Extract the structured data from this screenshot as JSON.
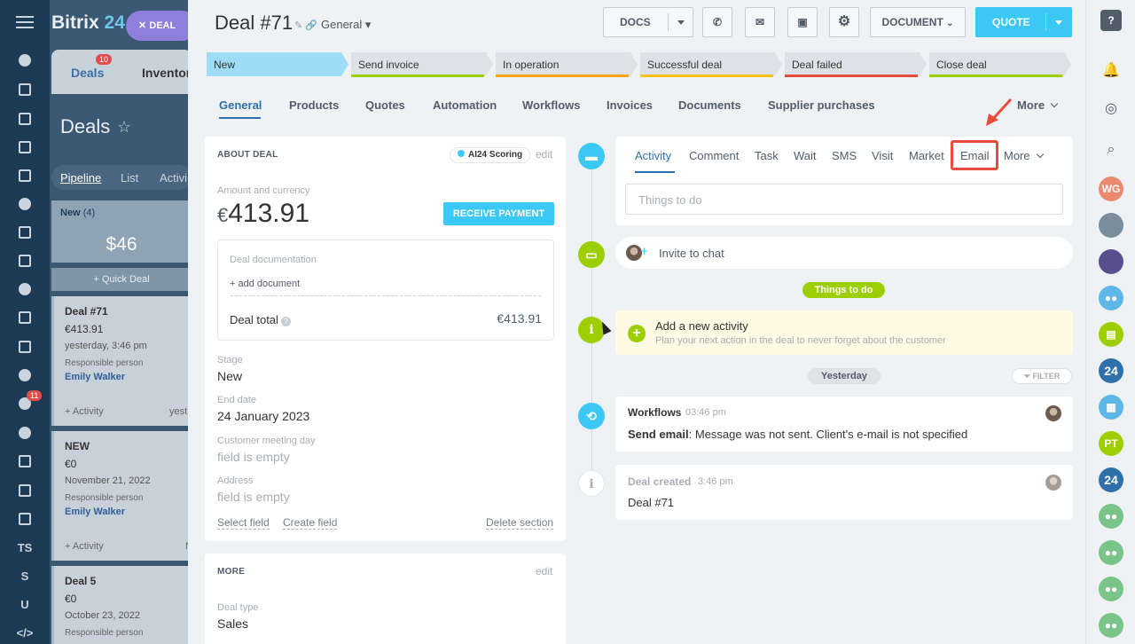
{
  "background": {
    "logo_text": "Bitrix",
    "logo_num": "24",
    "deal_chip": "DEAL",
    "tabs": {
      "deals": "Deals",
      "deals_badge": "10",
      "inventory": "Inventor"
    },
    "title": "Deals",
    "views": [
      "Pipeline",
      "List",
      "Activi"
    ],
    "column": {
      "name": "New",
      "count": "(4)",
      "sum": "$46",
      "quick": "+ Quick Deal"
    },
    "cards": [
      {
        "title": "Deal #71",
        "value": "€413.91",
        "date": "yesterday, 3:46 pm",
        "resp_label": "Responsible person",
        "resp": "Emily Walker",
        "activity": "+ Activity",
        "extra": "yest"
      },
      {
        "title": "NEW",
        "value": "€0",
        "date": "November 21, 2022",
        "resp_label": "Responsible person",
        "resp": "Emily Walker",
        "activity": "+ Activity",
        "extra": "N"
      },
      {
        "title": "Deal 5",
        "value": "€0",
        "date": "October 23, 2022",
        "resp_label": "Responsible person"
      }
    ],
    "nav_badge": "11",
    "nav_texts": [
      "TS",
      "S",
      "U",
      "</>"
    ]
  },
  "header": {
    "title": "Deal #71",
    "category": "General",
    "buttons": {
      "docs": "DOCS",
      "document": "DOCUMENT",
      "quote": "QUOTE"
    }
  },
  "stages": [
    {
      "label": "New",
      "color": "#9fdcf6"
    },
    {
      "label": "Send invoice",
      "color": "#9dcf00"
    },
    {
      "label": "In operation",
      "color": "#f9a31a"
    },
    {
      "label": "Successful deal",
      "color": "#f9c31a"
    },
    {
      "label": "Deal failed",
      "color": "#e84c3d"
    },
    {
      "label": "Close deal",
      "color": "#9dcf00"
    }
  ],
  "tabs": [
    "General",
    "Products",
    "Quotes",
    "Automation",
    "Workflows",
    "Invoices",
    "Documents",
    "Supplier purchases",
    "More"
  ],
  "about": {
    "heading": "ABOUT DEAL",
    "ai_scoring": "AI24 Scoring",
    "edit": "edit",
    "amount_label": "Amount and currency",
    "currency": "€",
    "amount": "413.91",
    "receive_payment": "RECEIVE PAYMENT",
    "doc_label": "Deal documentation",
    "add_document": "+ add document",
    "deal_total_label": "Deal total",
    "deal_total": "€413.91",
    "fields": [
      {
        "label": "Stage",
        "value": "New"
      },
      {
        "label": "End date",
        "value": "24 January 2023"
      },
      {
        "label": "Customer meeting day",
        "value": "field is empty"
      },
      {
        "label": "Address",
        "value": "field is empty"
      }
    ],
    "select_field": "Select field",
    "create_field": "Create field",
    "delete_section": "Delete section"
  },
  "more": {
    "heading": "MORE",
    "edit": "edit",
    "deal_type_label": "Deal type",
    "deal_type": "Sales"
  },
  "activity": {
    "tabs": [
      "Activity",
      "Comment",
      "Task",
      "Wait",
      "SMS",
      "Visit",
      "Market",
      "Email",
      "More"
    ],
    "placeholder": "Things to do",
    "invite": "Invite to chat",
    "things_to_do": "Things to do",
    "add_title": "Add a new activity",
    "add_sub": "Plan your next action in the deal to never forget about the customer",
    "yesterday": "Yesterday",
    "filter": "FILTER",
    "workflow": {
      "title": "Workflows",
      "time": "03:46 pm",
      "bold": "Send email",
      "text": ": Message was not sent. Client's e-mail is not specified"
    },
    "created": {
      "title": "Deal created",
      "time": "3:46 pm",
      "text": "Deal #71"
    }
  },
  "right_bar": {
    "initials_wg": "WG",
    "initials_pt": "PT",
    "num_24": "24"
  }
}
